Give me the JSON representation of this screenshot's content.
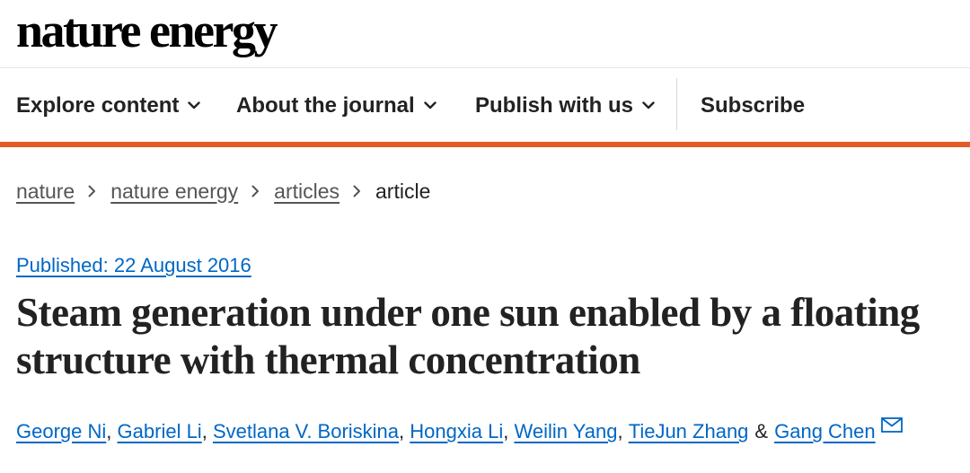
{
  "site": {
    "logo": "nature energy"
  },
  "nav": {
    "items": [
      {
        "label": "Explore content",
        "icon": "chevron-down-icon"
      },
      {
        "label": "About the journal",
        "icon": "chevron-down-icon"
      },
      {
        "label": "Publish with us",
        "icon": "chevron-down-icon"
      },
      {
        "label": "Subscribe"
      }
    ]
  },
  "colors": {
    "accent": "#e35c26",
    "link": "#0067c5",
    "text": "#222222"
  },
  "breadcrumb": [
    {
      "label": "nature"
    },
    {
      "label": "nature energy"
    },
    {
      "label": "articles"
    },
    {
      "label": "article"
    }
  ],
  "article": {
    "published": "Published: 22 August 2016",
    "title": "Steam generation under one sun enabled by a floating structure with thermal concentration",
    "authors": [
      "George Ni",
      "Gabriel Li",
      "Svetlana V. Boriskina",
      "Hongxia Li",
      "Weilin Yang",
      "TieJun Zhang",
      "Gang Chen"
    ],
    "separator": ",",
    "conjunction": "&",
    "contact_icon": "mail-icon"
  }
}
